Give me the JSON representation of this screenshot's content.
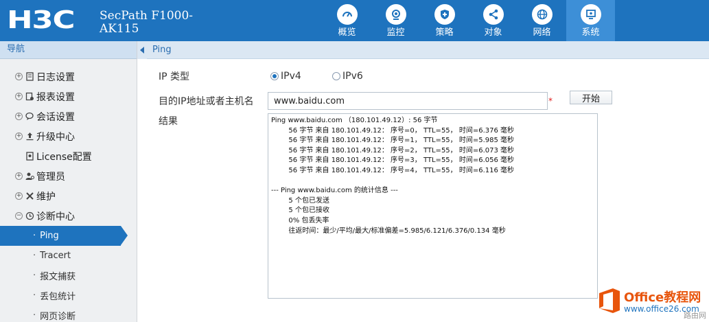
{
  "header": {
    "logo": "H3C",
    "product_line1": "SecPath F1000-",
    "product_line2": "AK115",
    "brand_color": "#1e73be",
    "nav": [
      {
        "label": "概览",
        "icon": "dashboard-icon"
      },
      {
        "label": "监控",
        "icon": "monitor-icon"
      },
      {
        "label": "策略",
        "icon": "shield-plus-icon"
      },
      {
        "label": "对象",
        "icon": "share-nodes-icon"
      },
      {
        "label": "网络",
        "icon": "globe-icon"
      },
      {
        "label": "系统",
        "icon": "system-screen-icon",
        "active": true
      }
    ]
  },
  "sidebar": {
    "title": "导航",
    "items": [
      {
        "label": "日志设置",
        "icon": "log-icon"
      },
      {
        "label": "报表设置",
        "icon": "report-icon"
      },
      {
        "label": "会话设置",
        "icon": "session-icon"
      },
      {
        "label": "升级中心",
        "icon": "upgrade-icon"
      },
      {
        "label": "License配置",
        "icon": "license-icon"
      },
      {
        "label": "管理员",
        "icon": "admin-icon"
      },
      {
        "label": "维护",
        "icon": "maintenance-icon"
      },
      {
        "label": "诊断中心",
        "icon": "diagnose-icon"
      }
    ],
    "subitems": [
      {
        "label": "Ping",
        "selected": true
      },
      {
        "label": "Tracert"
      },
      {
        "label": "报文捕获"
      },
      {
        "label": "丢包统计"
      },
      {
        "label": "网页诊断"
      }
    ]
  },
  "content": {
    "title": "Ping",
    "ip_type_label": "IP 类型",
    "ipv4_label": "IPv4",
    "ipv6_label": "IPv6",
    "ipv4_selected": true,
    "target_label": "目的IP地址或者主机名",
    "target_value": "www.baidu.com",
    "required_mark": "*",
    "start_button": "开始",
    "result_label": "结果",
    "result_text": "Ping www.baidu.com （180.101.49.12）: 56 字节\n        56 字节 来自 180.101.49.12： 序号=0， TTL=55， 时间=6.376 毫秒\n        56 字节 来自 180.101.49.12： 序号=1， TTL=55， 时间=5.985 毫秒\n        56 字节 来自 180.101.49.12： 序号=2， TTL=55， 时间=6.073 毫秒\n        56 字节 来自 180.101.49.12： 序号=3， TTL=55， 时间=6.056 毫秒\n        56 字节 来自 180.101.49.12： 序号=4， TTL=55， 时间=6.116 毫秒\n\n--- Ping www.baidu.com 的统计信息 ---\n        5 个包已发送\n        5 个包已接收\n        0% 包丢失率\n        往返时间：最少/平均/最大/标准偏差=5.985/6.121/6.376/0.134 毫秒"
  },
  "watermark": {
    "name": "Office教程网",
    "url": "www.office26.com",
    "corner": "路由网"
  }
}
